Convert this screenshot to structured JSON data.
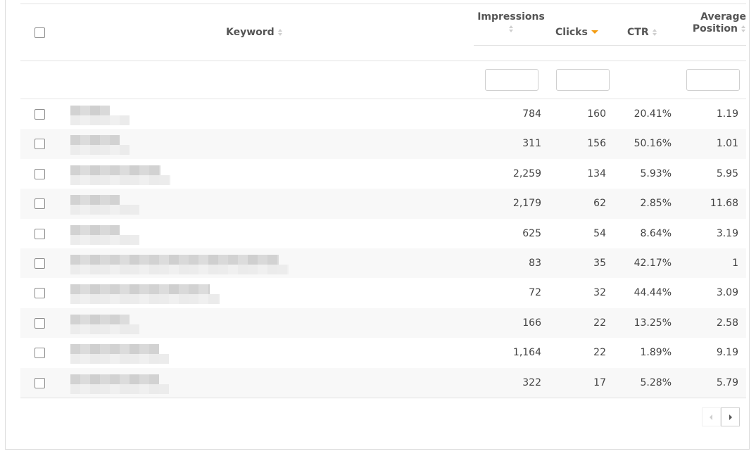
{
  "table": {
    "columns": [
      {
        "key": "keyword",
        "label": "Keyword",
        "sort": "none"
      },
      {
        "key": "impressions",
        "label": "Impressions",
        "sort": "none"
      },
      {
        "key": "clicks",
        "label": "Clicks",
        "sort": "descending"
      },
      {
        "key": "ctr",
        "label": "CTR",
        "sort": "none"
      },
      {
        "key": "average_position",
        "label": "Average Position",
        "label_line1": "Average",
        "label_line2": "Position",
        "sort": "none"
      }
    ],
    "filters": {
      "impressions": "",
      "clicks": "",
      "average_position": ""
    },
    "sort_icons": {
      "unsorted": "sort-both-icon",
      "active": "sort-desc-icon",
      "active_color": "#f39c12"
    },
    "rows": [
      {
        "keyword": "[redacted]",
        "impressions": "784",
        "clicks": "160",
        "ctr": "20.41%",
        "average_position": "1.19",
        "checked": false
      },
      {
        "keyword": "[redacted]",
        "impressions": "311",
        "clicks": "156",
        "ctr": "50.16%",
        "average_position": "1.01",
        "checked": false
      },
      {
        "keyword": "[redacted]",
        "impressions": "2,259",
        "clicks": "134",
        "ctr": "5.93%",
        "average_position": "5.95",
        "checked": false
      },
      {
        "keyword": "[redacted]",
        "impressions": "2,179",
        "clicks": "62",
        "ctr": "2.85%",
        "average_position": "11.68",
        "checked": false
      },
      {
        "keyword": "[redacted]",
        "impressions": "625",
        "clicks": "54",
        "ctr": "8.64%",
        "average_position": "3.19",
        "checked": false
      },
      {
        "keyword": "[redacted]",
        "impressions": "83",
        "clicks": "35",
        "ctr": "42.17%",
        "average_position": "1",
        "checked": false
      },
      {
        "keyword": "[redacted]",
        "impressions": "72",
        "clicks": "32",
        "ctr": "44.44%",
        "average_position": "3.09",
        "checked": false
      },
      {
        "keyword": "[redacted]",
        "impressions": "166",
        "clicks": "22",
        "ctr": "13.25%",
        "average_position": "2.58",
        "checked": false
      },
      {
        "keyword": "[redacted]",
        "impressions": "1,164",
        "clicks": "22",
        "ctr": "1.89%",
        "average_position": "9.19",
        "checked": false
      },
      {
        "keyword": "[redacted]",
        "impressions": "322",
        "clicks": "17",
        "ctr": "5.28%",
        "average_position": "5.79",
        "checked": false
      }
    ]
  },
  "pagination": {
    "prev_icon": "chevron-left-icon",
    "next_icon": "chevron-right-icon",
    "prev_disabled": true,
    "next_disabled": false
  }
}
